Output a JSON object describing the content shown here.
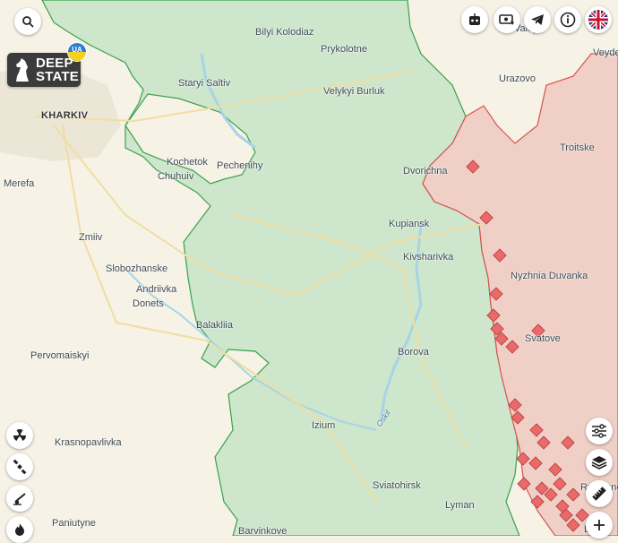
{
  "map": {
    "colors": {
      "land": "#f6f2e6",
      "liberated": "#cde6cc",
      "liberated_border": "#3aa24a",
      "occupied": "#efcfc6",
      "occupied_border": "#d9534f",
      "water": "#a8d4e6",
      "road": "#f0dea0"
    },
    "places": {
      "kharkiv": "KHARKIV",
      "merefa": "Merefa",
      "zmiiv": "Zmiiv",
      "slobozhanske": "Slobozhanske",
      "andriivka": "Andriivka",
      "donets": "Donets",
      "balakliia": "Balakliia",
      "pervomaiskyi": "Pervomaiskyi",
      "krasnopavlivka": "Krasnopavlivka",
      "paniutyne": "Paniutyne",
      "barvinkove": "Barvinkove",
      "izium": "Izium",
      "borova": "Borova",
      "kupiansk": "Kupiansk",
      "kivsharivka": "Kivsharivka",
      "dvorichna": "Dvorichna",
      "pechenihy": "Pechenihy",
      "kochetok": "Kochetok",
      "chuhuiv": "Chuhuiv",
      "staryi_saltiv": "Staryi Saltiv",
      "bilyi_kolodiaz": "Bilyi Kolodiaz",
      "prykolotne": "Prykolotne",
      "velykyi_burluk": "Velykyi Burluk",
      "urazovo": "Urazovo",
      "valuyki": "Valuyki",
      "veydelevka": "Veyde",
      "troitske": "Troitske",
      "nyzhnia_duvanka": "Nyzhnia Duvanka",
      "svatove": "Svatove",
      "sviatohirsk": "Sviatohirsk",
      "lyman": "Lyman",
      "rubizhne": "Rubizhne",
      "lysychansk": "L",
      "oskil_river": "Oskil"
    }
  },
  "brand": {
    "line1": "DEEP",
    "line2": "STATE",
    "badge": "UA"
  },
  "controls": {
    "top_right": [
      "robot-icon",
      "donate-icon",
      "telegram-icon",
      "info-icon",
      "uk-flag-icon"
    ],
    "left": [
      "radiation-icon",
      "satellite-icon",
      "artillery-icon",
      "fire-icon"
    ],
    "right": [
      "settings-sliders-icon",
      "layers-icon",
      "ruler-icon",
      "zoom-in-icon"
    ]
  }
}
